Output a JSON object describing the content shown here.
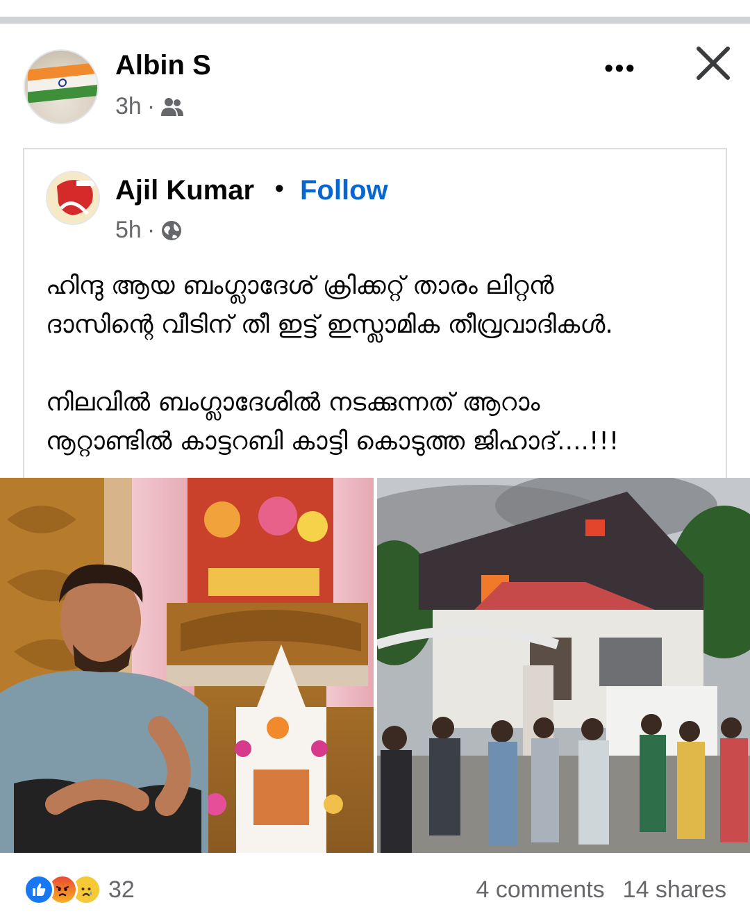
{
  "outer_post": {
    "author": "Albin S",
    "time": "3h",
    "separator": "·",
    "audience_icon": "friends-icon"
  },
  "menu": {
    "more_label": "•••"
  },
  "shared_post": {
    "author": "Ajil Kumar",
    "dot": "•",
    "follow_label": "Follow",
    "time": "5h",
    "separator": "·",
    "audience_icon": "globe-icon",
    "paragraphs": [
      [
        "ഹിന്ദു ആയ ബംഗ്ലാദേശ് ക്രിക്കറ്റ് താരം ലിറ്റൻ",
        "ദാസിന്റെ വീടിന്  തീ ഇട്ട് ഇസ്ലാമിക തീവ്രവാദികൾ."
      ],
      [
        "നിലവിൽ ബംഗ്ലാദേശിൽ നടക്കുന്നത് ആറാം",
        "നൂറ്റാണ്ടിൽ കാട്ടറബി കാട്ടി കൊടുത്ത ജിഹാദ്....!!!"
      ]
    ]
  },
  "footer": {
    "reaction_count": "32",
    "comments": "4 comments",
    "shares": "14 shares"
  },
  "colors": {
    "follow": "#0866d1",
    "secondary_text": "#65676b",
    "like": "#1877f2"
  }
}
